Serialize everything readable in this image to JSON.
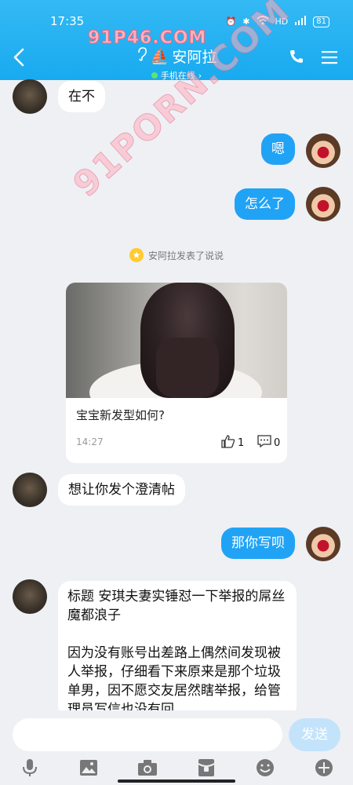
{
  "status_bar": {
    "time": "17:35",
    "battery": "81"
  },
  "watermarks": {
    "top": "91P46.COM",
    "diagonal": "91PORN.COM"
  },
  "header": {
    "title": "安阿拉",
    "status": "手机在线"
  },
  "messages": [
    {
      "side": "in",
      "text": "在不"
    },
    {
      "side": "out",
      "text": "嗯"
    },
    {
      "side": "out",
      "text": "怎么了"
    }
  ],
  "system_notice": "安阿拉发表了说说",
  "post_card": {
    "text": "宝宝新发型如何?",
    "time": "14:27",
    "likes": "1",
    "comments": "0"
  },
  "messages2": [
    {
      "side": "in",
      "text": "想让你发个澄清帖"
    },
    {
      "side": "out",
      "text": "那你写呗"
    }
  ],
  "long_message": {
    "p1": "标题 安琪夫妻实锤怼一下举报的屌丝 魔都浪子",
    "p2": "因为没有账号出差路上偶然间发现被人举报，仔细看下来原来是那个垃圾单男，因不愿交友居然瞎举报，给管理员写信也没有回"
  },
  "input": {
    "placeholder": "",
    "send_label": "发送"
  },
  "colors": {
    "header": "#1aabf1",
    "bubble_out": "#21a3f5",
    "bubble_in": "#ffffff",
    "background": "#eef0f4"
  }
}
